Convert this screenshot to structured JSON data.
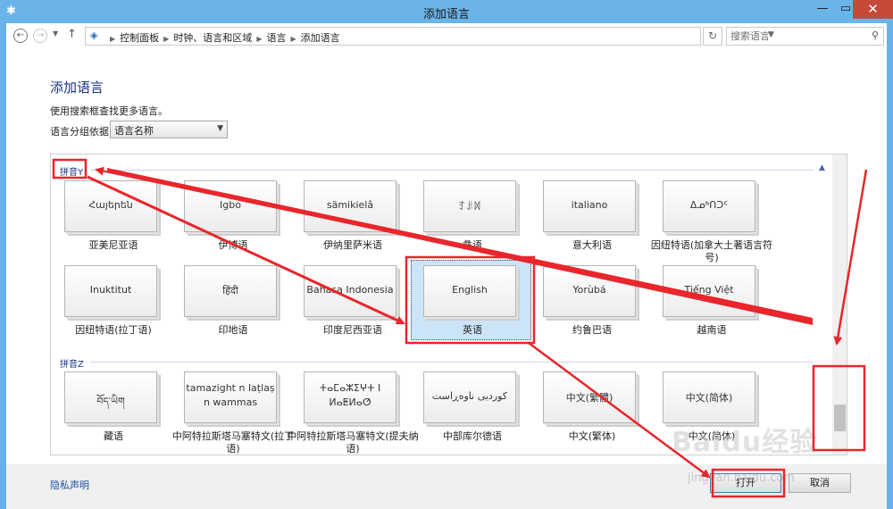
{
  "window": {
    "title": "添加语言",
    "min_glyph": "—",
    "max_glyph": "▭",
    "close_glyph": "✕"
  },
  "nav": {
    "breadcrumbs": [
      "控制面板",
      "时钟、语言和区域",
      "语言",
      "添加语言"
    ],
    "search_placeholder": "搜索语言"
  },
  "page": {
    "title": "添加语言",
    "description": "使用搜索框查找更多语言。",
    "group_by_label": "语言分组依据:",
    "group_by_value": "语言名称"
  },
  "groups": [
    {
      "header": "拼音Y",
      "languages": [
        {
          "native": "Հայերեն",
          "name": "亚美尼亚语"
        },
        {
          "native": "Igbo",
          "name": "伊博语"
        },
        {
          "native": "sämikielâ",
          "name": "伊纳里萨米语"
        },
        {
          "native": "ꆈꌠꉙ",
          "name": "彝语"
        },
        {
          "native": "italiano",
          "name": "意大利语"
        },
        {
          "native": "ᐃᓄᒃᑎᑐᑦ",
          "name": "因纽特语(加拿大土著语言符号)"
        },
        {
          "native": "Inuktitut",
          "name": "因纽特语(拉丁语)"
        },
        {
          "native": "हिंदी",
          "name": "印地语"
        },
        {
          "native": "Bahasa Indonesia",
          "name": "印度尼西亚语"
        },
        {
          "native": "English",
          "name": "英语",
          "selected": true
        },
        {
          "native": "Yorùbá",
          "name": "约鲁巴语"
        },
        {
          "native": "Tiếng Việt",
          "name": "越南语"
        }
      ]
    },
    {
      "header": "拼音Z",
      "languages": [
        {
          "native": "བོད་ཡིག",
          "name": "藏语"
        },
        {
          "native": "tamazight n laṭlaṣ n wammas",
          "name": "中阿特拉斯塔马塞特文(拉丁语)"
        },
        {
          "native": "ⵜⴰⵎⴰⵣⵉⵖⵜ ⵏ ⵍⴰⵟⵍⴰⵚ",
          "name": "中阿特拉斯塔马塞特文(提夫纳语)"
        },
        {
          "native": "کوردیی ناوەڕاست",
          "name": "中部库尔德语"
        },
        {
          "native": "中文(繁體)",
          "name": "中文(繁体)"
        },
        {
          "native": "中文(简体)",
          "name": "中文(简体)"
        }
      ]
    }
  ],
  "footer": {
    "privacy_link": "隐私声明",
    "open_button": "打开",
    "cancel_button": "取消"
  },
  "watermark": {
    "main": "Baidu经验",
    "sub": "jingyan.baidu.com"
  },
  "colors": {
    "titlebar": "#6ab4ea",
    "close_button": "#c7493a",
    "link_blue": "#1e3287",
    "selection_fill": "#cce4f7",
    "annotation_red": "#e8262c"
  },
  "icons": {
    "app": "control-panel-icon",
    "back": "back-arrow-icon",
    "forward": "forward-arrow-icon",
    "up": "up-arrow-icon",
    "refresh": "refresh-icon",
    "search": "search-icon"
  }
}
